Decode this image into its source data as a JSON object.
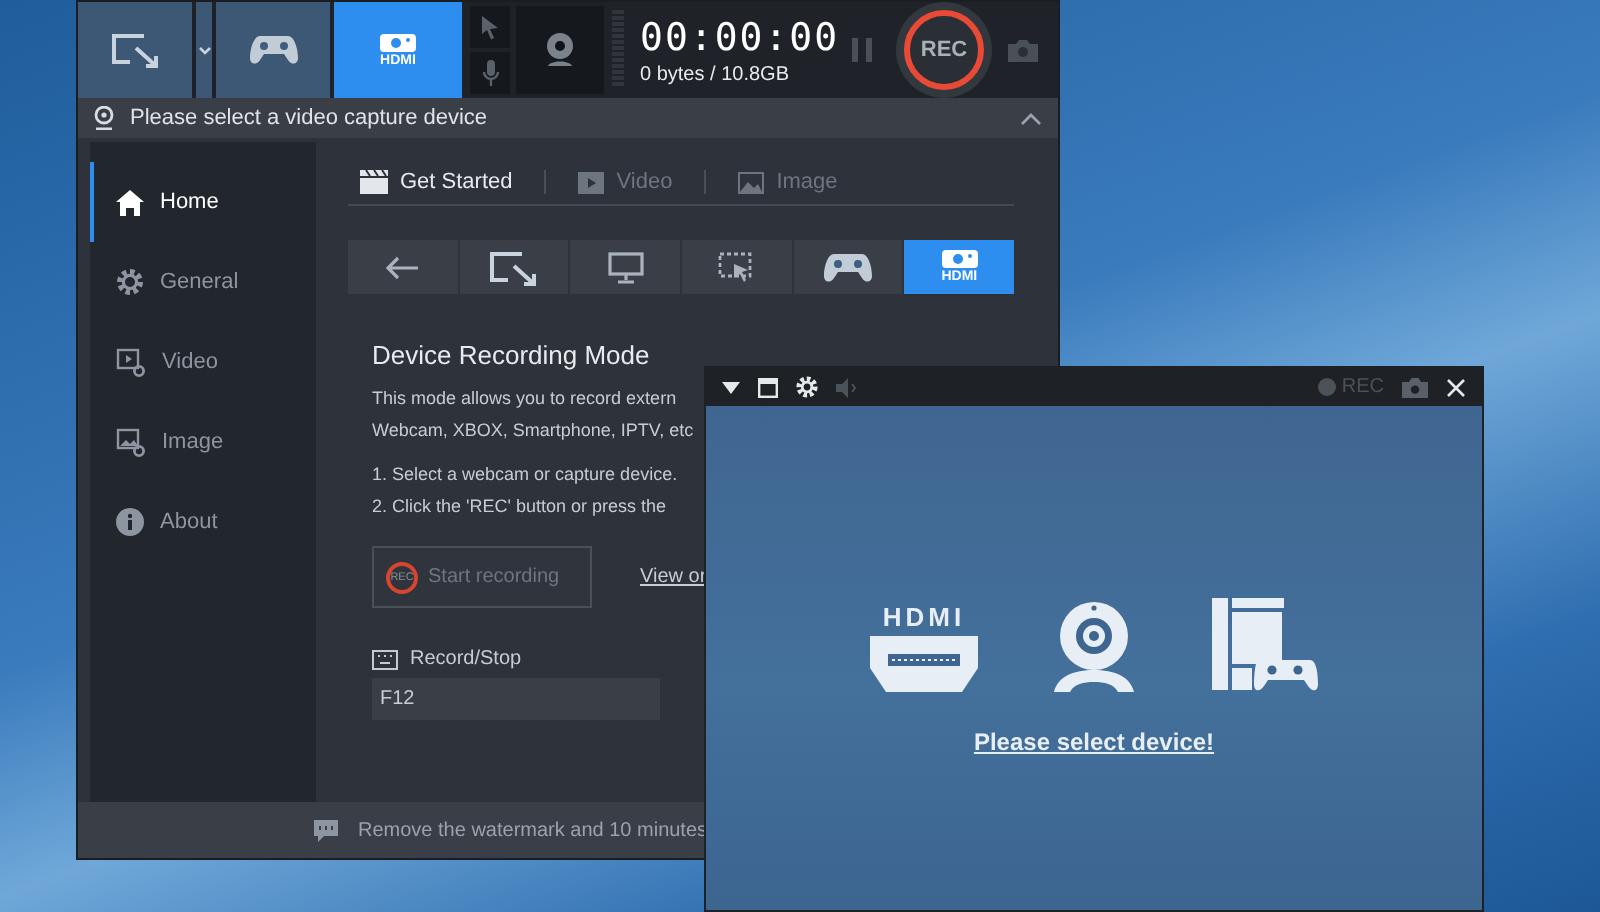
{
  "main_window": {
    "toolbar": {
      "modes": [
        {
          "kind": "region",
          "selected": false
        },
        {
          "kind": "game",
          "selected": false
        },
        {
          "kind": "device",
          "label": "HDMI",
          "selected": true
        }
      ],
      "timer": "00:00:00",
      "size": "0 bytes / 10.8GB",
      "rec": "REC"
    },
    "device_bar": {
      "text": "Please select a video capture device"
    },
    "sidebar": {
      "items": [
        {
          "kind": "home",
          "label": "Home",
          "selected": true
        },
        {
          "kind": "general",
          "label": "General",
          "selected": false
        },
        {
          "kind": "video",
          "label": "Video",
          "selected": false
        },
        {
          "kind": "image",
          "label": "Image",
          "selected": false
        },
        {
          "kind": "about",
          "label": "About",
          "selected": false
        }
      ]
    },
    "tabs": [
      {
        "kind": "get-started",
        "label": "Get Started",
        "selected": true
      },
      {
        "kind": "video",
        "label": "Video",
        "selected": false
      },
      {
        "kind": "image",
        "label": "Image",
        "selected": false
      }
    ],
    "mode_buttons": [
      {
        "kind": "back",
        "selected": false
      },
      {
        "kind": "region",
        "selected": false
      },
      {
        "kind": "fullscreen",
        "selected": false
      },
      {
        "kind": "area",
        "selected": false
      },
      {
        "kind": "game",
        "selected": false
      },
      {
        "kind": "device",
        "label": "HDMI",
        "selected": true
      }
    ],
    "content": {
      "title": "Device Recording Mode",
      "paragraph_lines": [
        "This mode allows you to record extern",
        "Webcam, XBOX, Smartphone, IPTV, etc"
      ],
      "steps": [
        "1. Select a webcam or capture device.",
        "2. Click the 'REC' button or press the"
      ],
      "start_button": {
        "icon_label": "REC",
        "label": "Start recording"
      },
      "link": "View or",
      "hotkey": {
        "label": "Record/Stop",
        "value": "F12"
      }
    },
    "footer": "Remove the watermark and 10 minutes"
  },
  "preview_window": {
    "rec": "REC",
    "message": "Please select device!",
    "devices": [
      {
        "kind": "hdmi",
        "label": "HDMI"
      },
      {
        "kind": "webcam"
      },
      {
        "kind": "console"
      }
    ]
  }
}
